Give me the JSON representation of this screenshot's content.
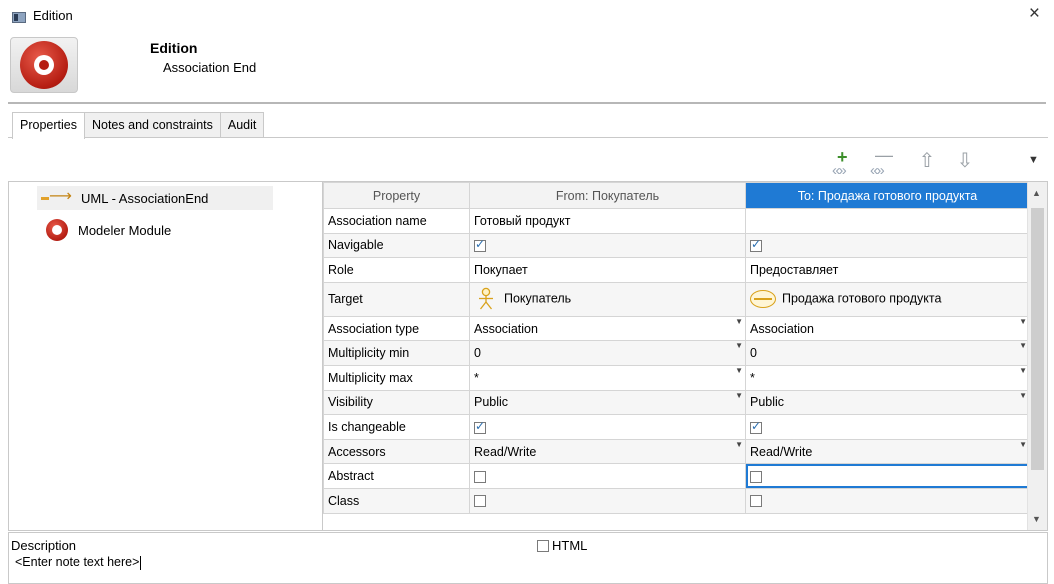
{
  "window": {
    "title": "Edition",
    "close_glyph": "×"
  },
  "header": {
    "title": "Edition",
    "subtitle": "Association End"
  },
  "tabs": [
    {
      "label": "Properties",
      "active": true
    },
    {
      "label": "Notes and constraints",
      "active": false
    },
    {
      "label": "Audit",
      "active": false
    }
  ],
  "toolbar": {
    "add_icon": "add-column-icon",
    "remove_icon": "remove-column-icon",
    "up_icon": "move-up-icon",
    "down_icon": "move-down-icon"
  },
  "tree": {
    "items": [
      {
        "label": "UML - AssociationEnd",
        "icon": "association-end-arrow-icon",
        "selected": true
      },
      {
        "label": "Modeler Module",
        "icon": "modeler-module-icon",
        "selected": false
      }
    ]
  },
  "grid": {
    "columns": [
      "Property",
      "From: Покупатель",
      "To: Продажа готового продукта"
    ],
    "rows": [
      {
        "property": "Association name",
        "from": "Готовый продукт",
        "to": ""
      },
      {
        "property": "Navigable",
        "from_checked": true,
        "to_checked": true
      },
      {
        "property": "Role",
        "from": "Покупает",
        "to": "Предоставляет"
      },
      {
        "property": "Target",
        "from": "Покупатель",
        "to": "Продажа готового продукта"
      },
      {
        "property": "Association type",
        "from": "Association",
        "to": "Association"
      },
      {
        "property": "Multiplicity min",
        "from": "0",
        "to": "0"
      },
      {
        "property": "Multiplicity max",
        "from": "*",
        "to": "*"
      },
      {
        "property": "Visibility",
        "from": "Public",
        "to": "Public"
      },
      {
        "property": "Is changeable",
        "from_checked": true,
        "to_checked": true
      },
      {
        "property": "Accessors",
        "from": "Read/Write",
        "to": "Read/Write"
      },
      {
        "property": "Abstract",
        "from_checked": false,
        "to_checked": false
      },
      {
        "property": "Class",
        "from_checked": false,
        "to_checked": false
      }
    ]
  },
  "description": {
    "label": "Description",
    "html_label": "HTML",
    "html_checked": false,
    "note_text": "<Enter note text here>"
  },
  "colors": {
    "accent": "#1f7ad4",
    "brand_red": "#b51d12"
  }
}
